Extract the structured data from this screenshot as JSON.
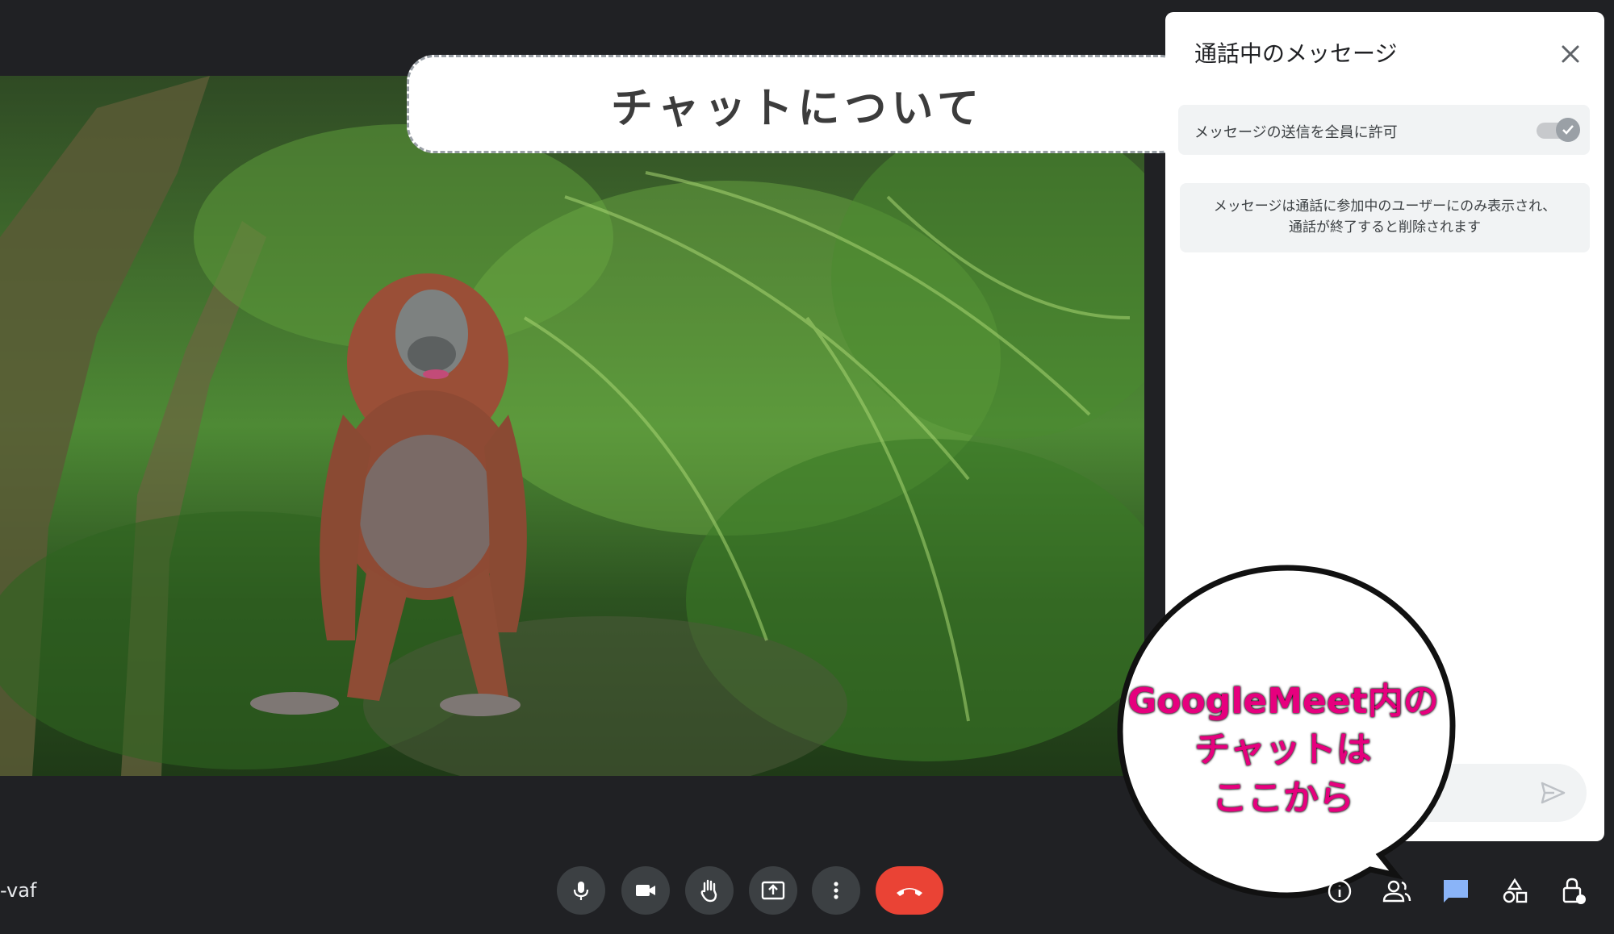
{
  "banner": {
    "title": "チャットについて"
  },
  "chat_panel": {
    "title": "通話中のメッセージ",
    "close_icon": "close-icon",
    "allow_messages_label": "メッセージの送信を全員に許可",
    "allow_messages_enabled": true,
    "info_line1": "メッセージは通話に参加中のユーザーにのみ表示され、",
    "info_line2": "通話が終了すると削除されます",
    "compose_placeholder": "",
    "send_icon": "send-icon"
  },
  "callout": {
    "line1": "GoogleMeet内の",
    "line2": "チャットは",
    "line3": "ここから"
  },
  "meeting": {
    "code_fragment": "-vaf"
  },
  "controls": [
    {
      "name": "microphone-icon"
    },
    {
      "name": "camera-icon"
    },
    {
      "name": "raise-hand-icon"
    },
    {
      "name": "present-screen-icon"
    },
    {
      "name": "more-options-icon"
    },
    {
      "name": "end-call-icon"
    }
  ],
  "right_controls": [
    {
      "name": "info-icon"
    },
    {
      "name": "people-icon"
    },
    {
      "name": "chat-icon",
      "active": true
    },
    {
      "name": "activities-icon"
    },
    {
      "name": "host-controls-icon"
    }
  ],
  "colors": {
    "background": "#202124",
    "end_call": "#ea4335",
    "chat_active": "#8ab4f8",
    "callout_text": "#e6007e"
  }
}
